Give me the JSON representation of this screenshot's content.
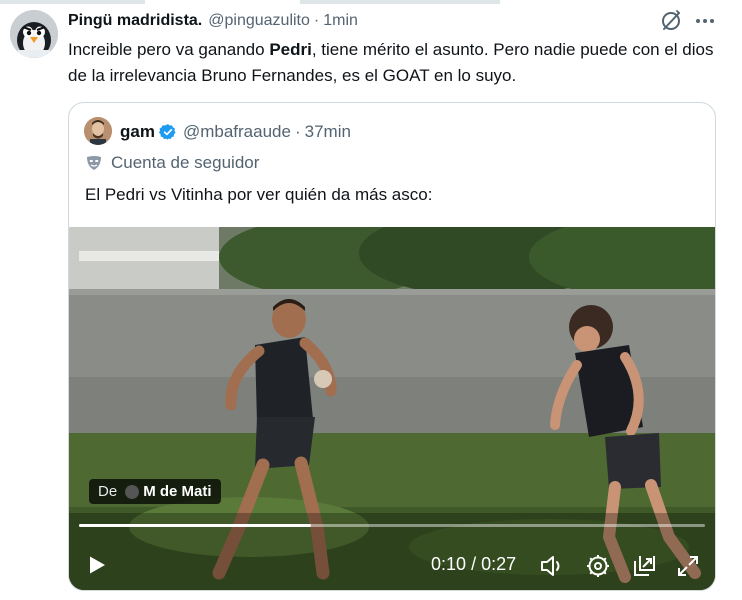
{
  "tweet": {
    "author_name": "Pingü madridista.",
    "handle": "@pinguazulito",
    "separator": "·",
    "time": "1min",
    "text_before": "Increible pero va ganando ",
    "text_bold": "Pedri",
    "text_after": ", tiene mérito el asunto. Pero nadie puede con el dios de la irrelevancia Bruno Fernandes, es el GOAT en lo suyo.",
    "icons": [
      "grok-icon",
      "more-icon"
    ]
  },
  "quote": {
    "author_name": "gam",
    "handle": "@mbafraaude",
    "separator": "·",
    "time": "37min",
    "label": "Cuenta de seguidor",
    "text": "El Pedri vs Vitinha por ver quién da más asco:",
    "verified_color": "#1d9bf0"
  },
  "video": {
    "source_prefix": "De",
    "source_name": "M de Mati",
    "current_time": "0:10",
    "time_separator": "/",
    "duration": "0:27",
    "progress_fraction": 0.37,
    "controls": [
      "play-icon",
      "volume-icon",
      "settings-icon",
      "popout-icon",
      "fullscreen-icon"
    ]
  }
}
